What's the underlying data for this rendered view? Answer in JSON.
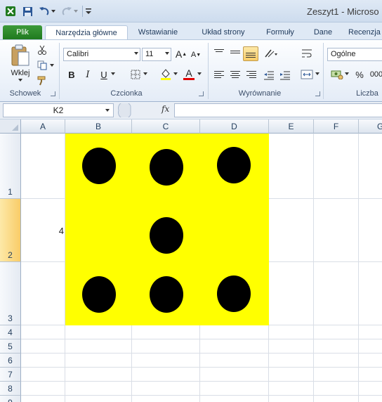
{
  "window": {
    "title": "Zeszyt1  -  Microso",
    "quick_access": [
      "excel-icon",
      "save-icon",
      "undo-icon",
      "redo-icon",
      "customize-icon"
    ]
  },
  "tabs": [
    {
      "label": "Plik"
    },
    {
      "label": "Narzędzia główne"
    },
    {
      "label": "Wstawianie"
    },
    {
      "label": "Układ strony"
    },
    {
      "label": "Formuły"
    },
    {
      "label": "Dane"
    },
    {
      "label": "Recenzja"
    }
  ],
  "ribbon": {
    "clipboard": {
      "label": "Schowek",
      "paste_label": "Wklej"
    },
    "font": {
      "label": "Czcionka",
      "font_name": "Calibri",
      "font_size": "11",
      "grow": "A",
      "shrink": "A",
      "bold": "B",
      "italic": "I",
      "underline": "U",
      "font_color_glyph": "A"
    },
    "alignment": {
      "label": "Wyrównanie"
    },
    "number": {
      "label": "Liczba",
      "format": "Ogólne",
      "percent": "%",
      "thousands": "000"
    }
  },
  "formula_bar": {
    "name_box": "K2",
    "fx_label": "fx",
    "formula": ""
  },
  "grid": {
    "columns": [
      "A",
      "B",
      "C",
      "D",
      "E",
      "F",
      "G"
    ],
    "rows": [
      "1",
      "2",
      "3",
      "4",
      "5",
      "6",
      "7",
      "8",
      "9"
    ],
    "active_row": "2",
    "cells": {
      "A2": "4"
    }
  },
  "colors": {
    "dice_fill": "#ffff00",
    "pip": "#000000",
    "file_tab": "#2a8a2a"
  }
}
